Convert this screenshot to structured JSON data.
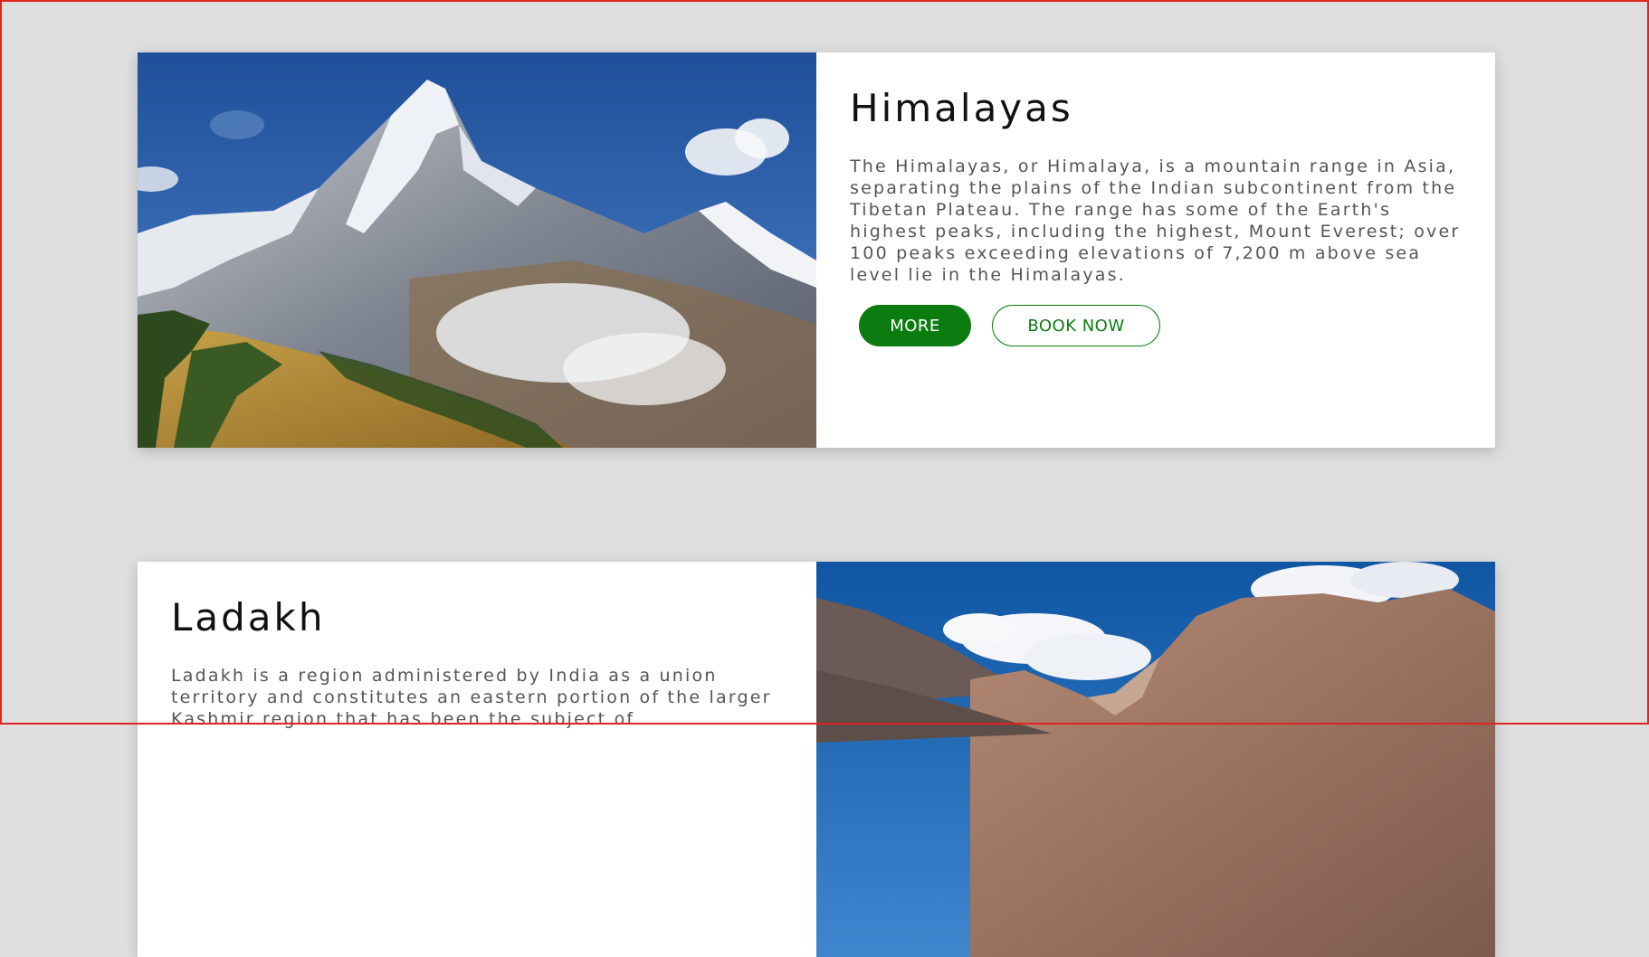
{
  "cards": [
    {
      "title": "Himalayas",
      "description": "The Himalayas, or Himalaya, is a mountain range in Asia, separating the plains of the Indian subcontinent from the Tibetan Plateau. The range has some of the Earth's highest peaks, including the highest, Mount Everest; over 100 peaks exceeding elevations of 7,200 m above sea level lie in the Himalayas.",
      "more_label": "MORE",
      "book_label": "BOOK NOW"
    },
    {
      "title": "Ladakh",
      "description": "Ladakh is a region administered by India as a union territory and constitutes an eastern portion of the larger Kashmir region that has been the subject of"
    }
  ],
  "colors": {
    "page_background": "#dedede",
    "accent_green": "#0b7d10",
    "frame_red": "#e0241f"
  }
}
